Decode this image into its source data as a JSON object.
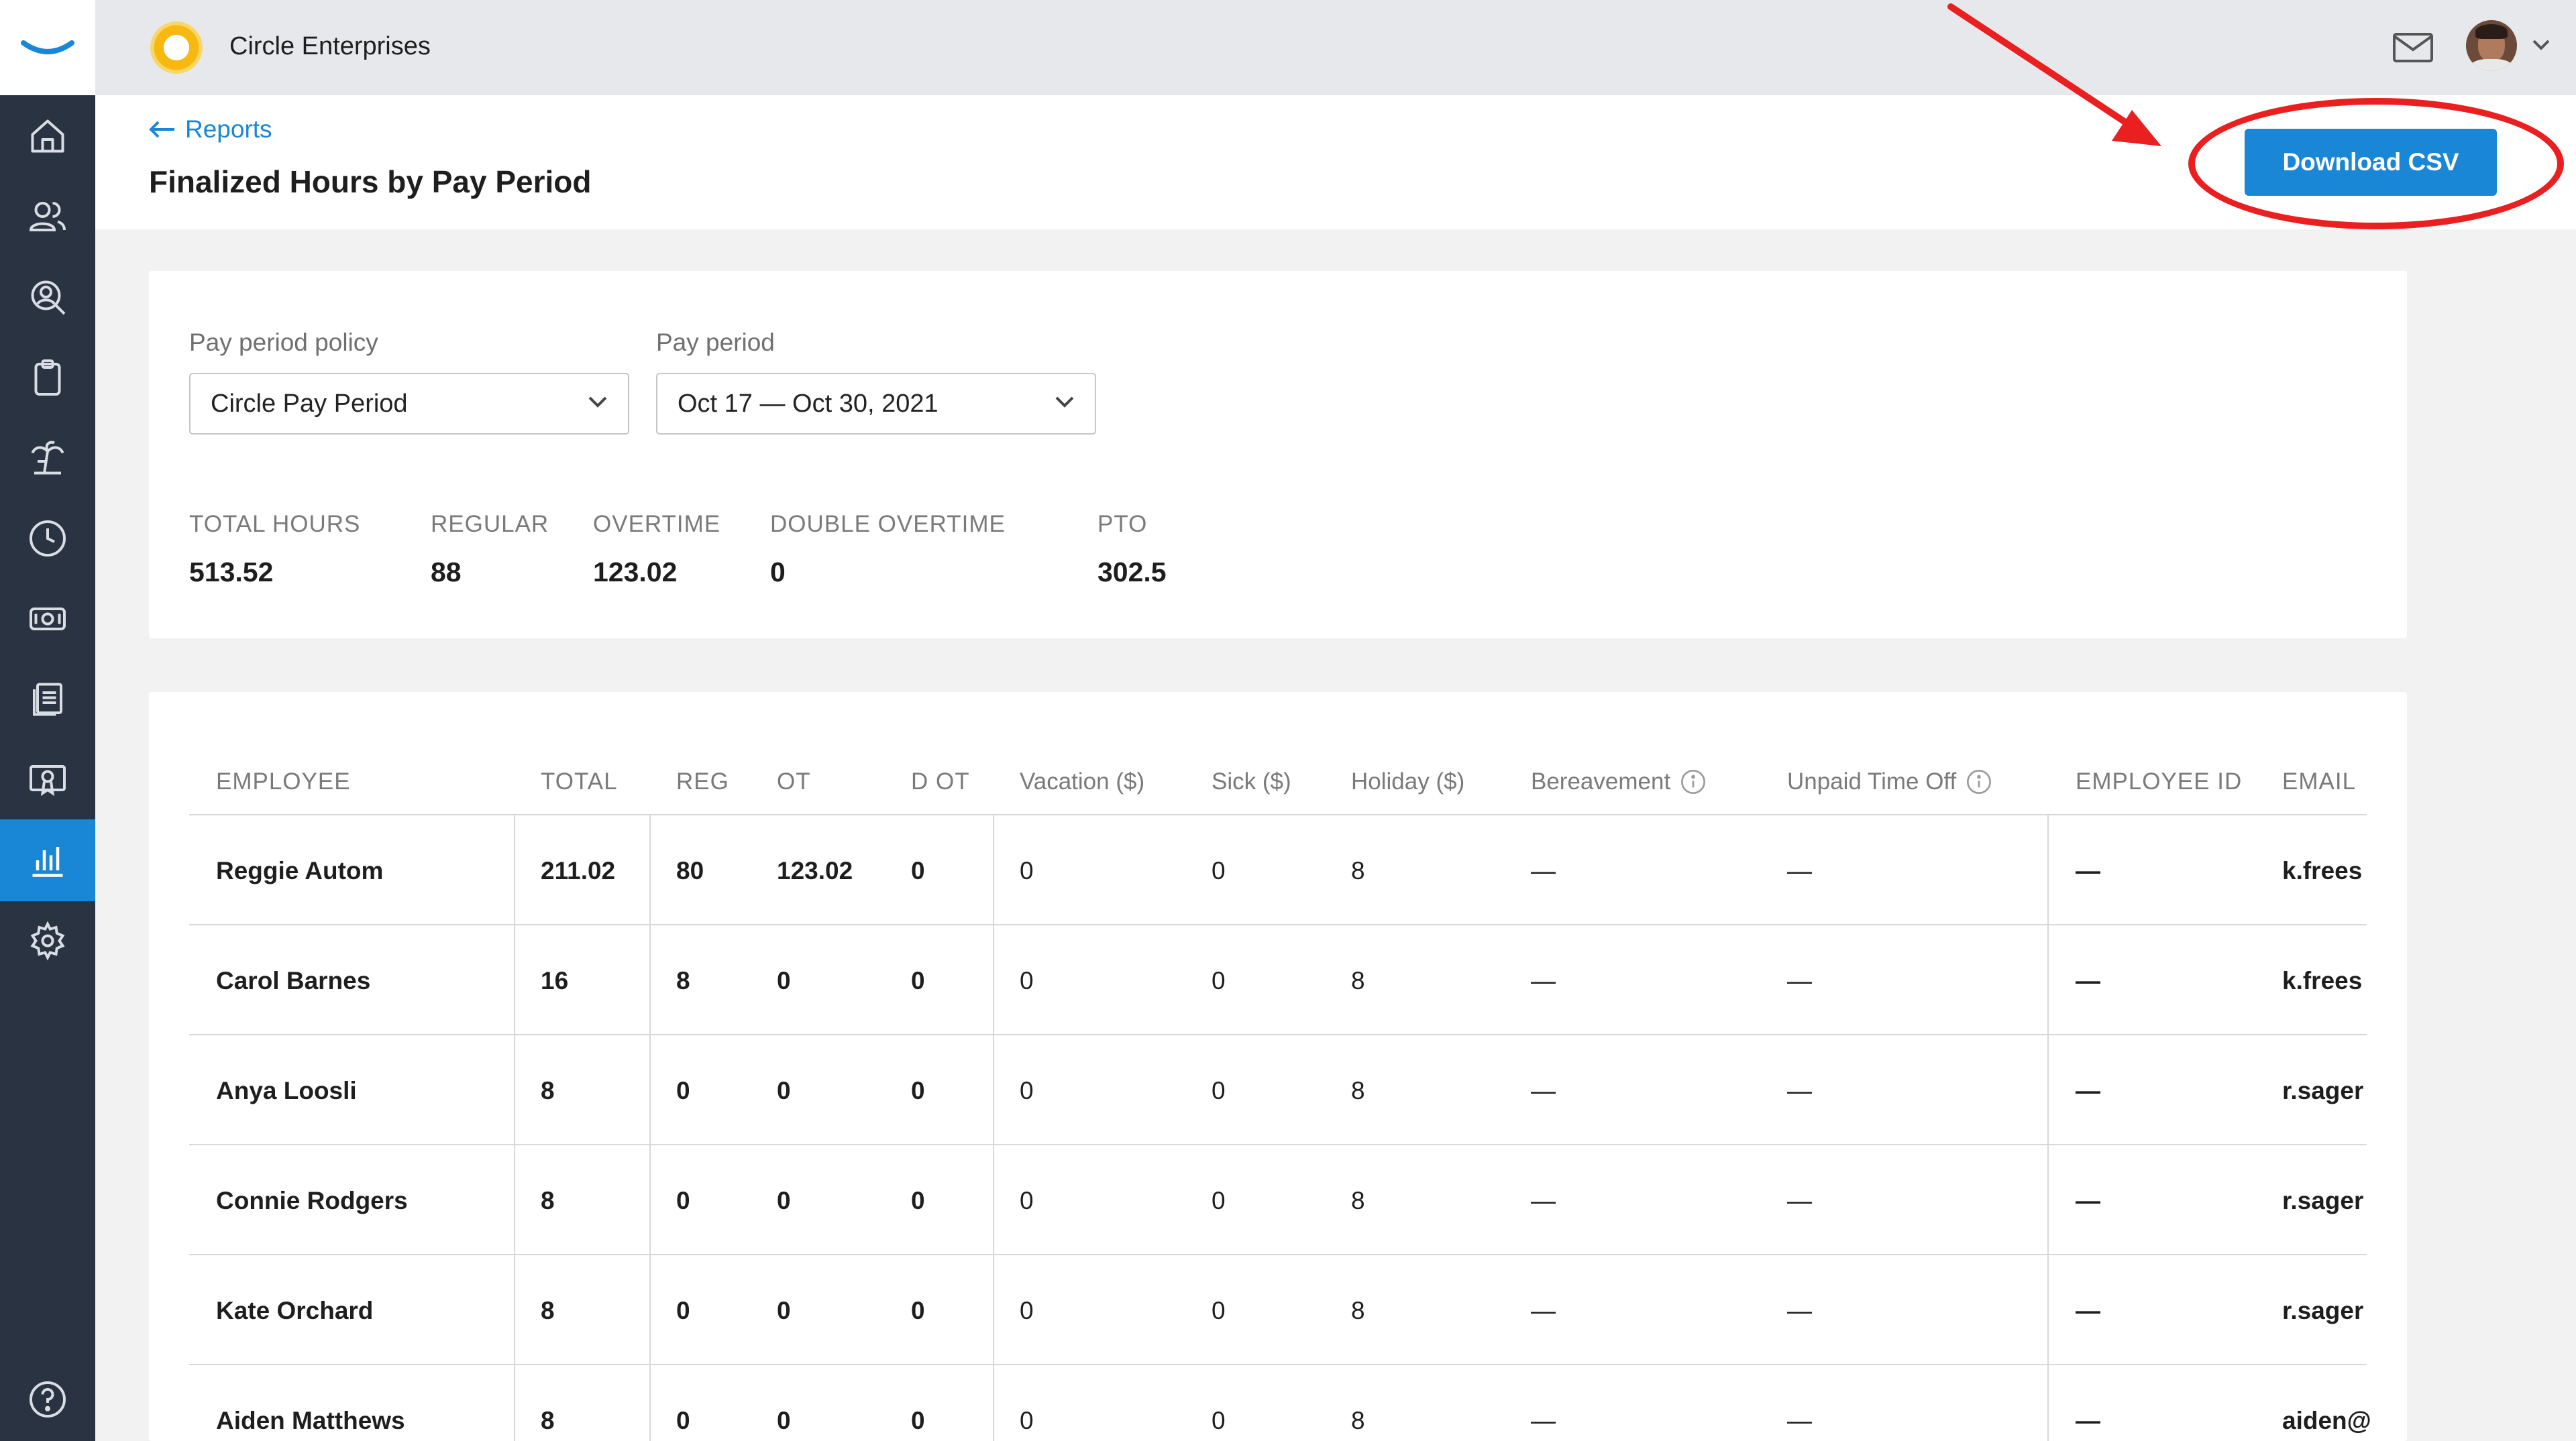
{
  "topbar": {
    "company_name": "Circle Enterprises"
  },
  "sidebar": {
    "items": [
      {
        "icon": "home-icon"
      },
      {
        "icon": "people-icon"
      },
      {
        "icon": "search-person-icon"
      },
      {
        "icon": "clipboard-icon"
      },
      {
        "icon": "palm-tree-icon"
      },
      {
        "icon": "clock-icon"
      },
      {
        "icon": "money-icon"
      },
      {
        "icon": "documents-icon"
      },
      {
        "icon": "certificate-icon"
      },
      {
        "icon": "bar-chart-icon",
        "active": true
      },
      {
        "icon": "gear-icon"
      },
      {
        "icon": "help-icon"
      }
    ]
  },
  "header": {
    "back_label": "Reports",
    "title": "Finalized Hours by Pay Period",
    "download_label": "Download CSV"
  },
  "filters": {
    "policy_label": "Pay period policy",
    "policy_value": "Circle Pay Period",
    "period_label": "Pay period",
    "period_value": "Oct 17 — Oct 30, 2021"
  },
  "stats": [
    {
      "label": "TOTAL HOURS",
      "value": "513.52"
    },
    {
      "label": "REGULAR",
      "value": "88"
    },
    {
      "label": "OVERTIME",
      "value": "123.02"
    },
    {
      "label": "DOUBLE OVERTIME",
      "value": "0"
    },
    {
      "label": "PTO",
      "value": "302.5"
    }
  ],
  "table": {
    "columns": [
      "EMPLOYEE",
      "TOTAL",
      "REG",
      "OT",
      "D OT",
      "Vacation ($)",
      "Sick ($)",
      "Holiday ($)",
      "Bereavement",
      "Unpaid Time Off",
      "EMPLOYEE ID",
      "EMAIL"
    ],
    "rows": [
      [
        "Reggie Autom",
        "211.02",
        "80",
        "123.02",
        "0",
        "0",
        "0",
        "8",
        "—",
        "—",
        "—",
        "k.frees"
      ],
      [
        "Carol Barnes",
        "16",
        "8",
        "0",
        "0",
        "0",
        "0",
        "8",
        "—",
        "—",
        "—",
        "k.frees"
      ],
      [
        "Anya Loosli",
        "8",
        "0",
        "0",
        "0",
        "0",
        "0",
        "8",
        "—",
        "—",
        "—",
        "r.sager"
      ],
      [
        "Connie Rodgers",
        "8",
        "0",
        "0",
        "0",
        "0",
        "0",
        "8",
        "—",
        "—",
        "—",
        "r.sager"
      ],
      [
        "Kate Orchard",
        "8",
        "0",
        "0",
        "0",
        "0",
        "0",
        "8",
        "—",
        "—",
        "—",
        "r.sager"
      ],
      [
        "Aiden Matthews",
        "8",
        "0",
        "0",
        "0",
        "0",
        "0",
        "8",
        "—",
        "—",
        "—",
        "aiden@"
      ]
    ]
  },
  "colors": {
    "accent": "#1a86d6",
    "sidebar": "#2a3342",
    "annotation": "#ea1f1f"
  }
}
